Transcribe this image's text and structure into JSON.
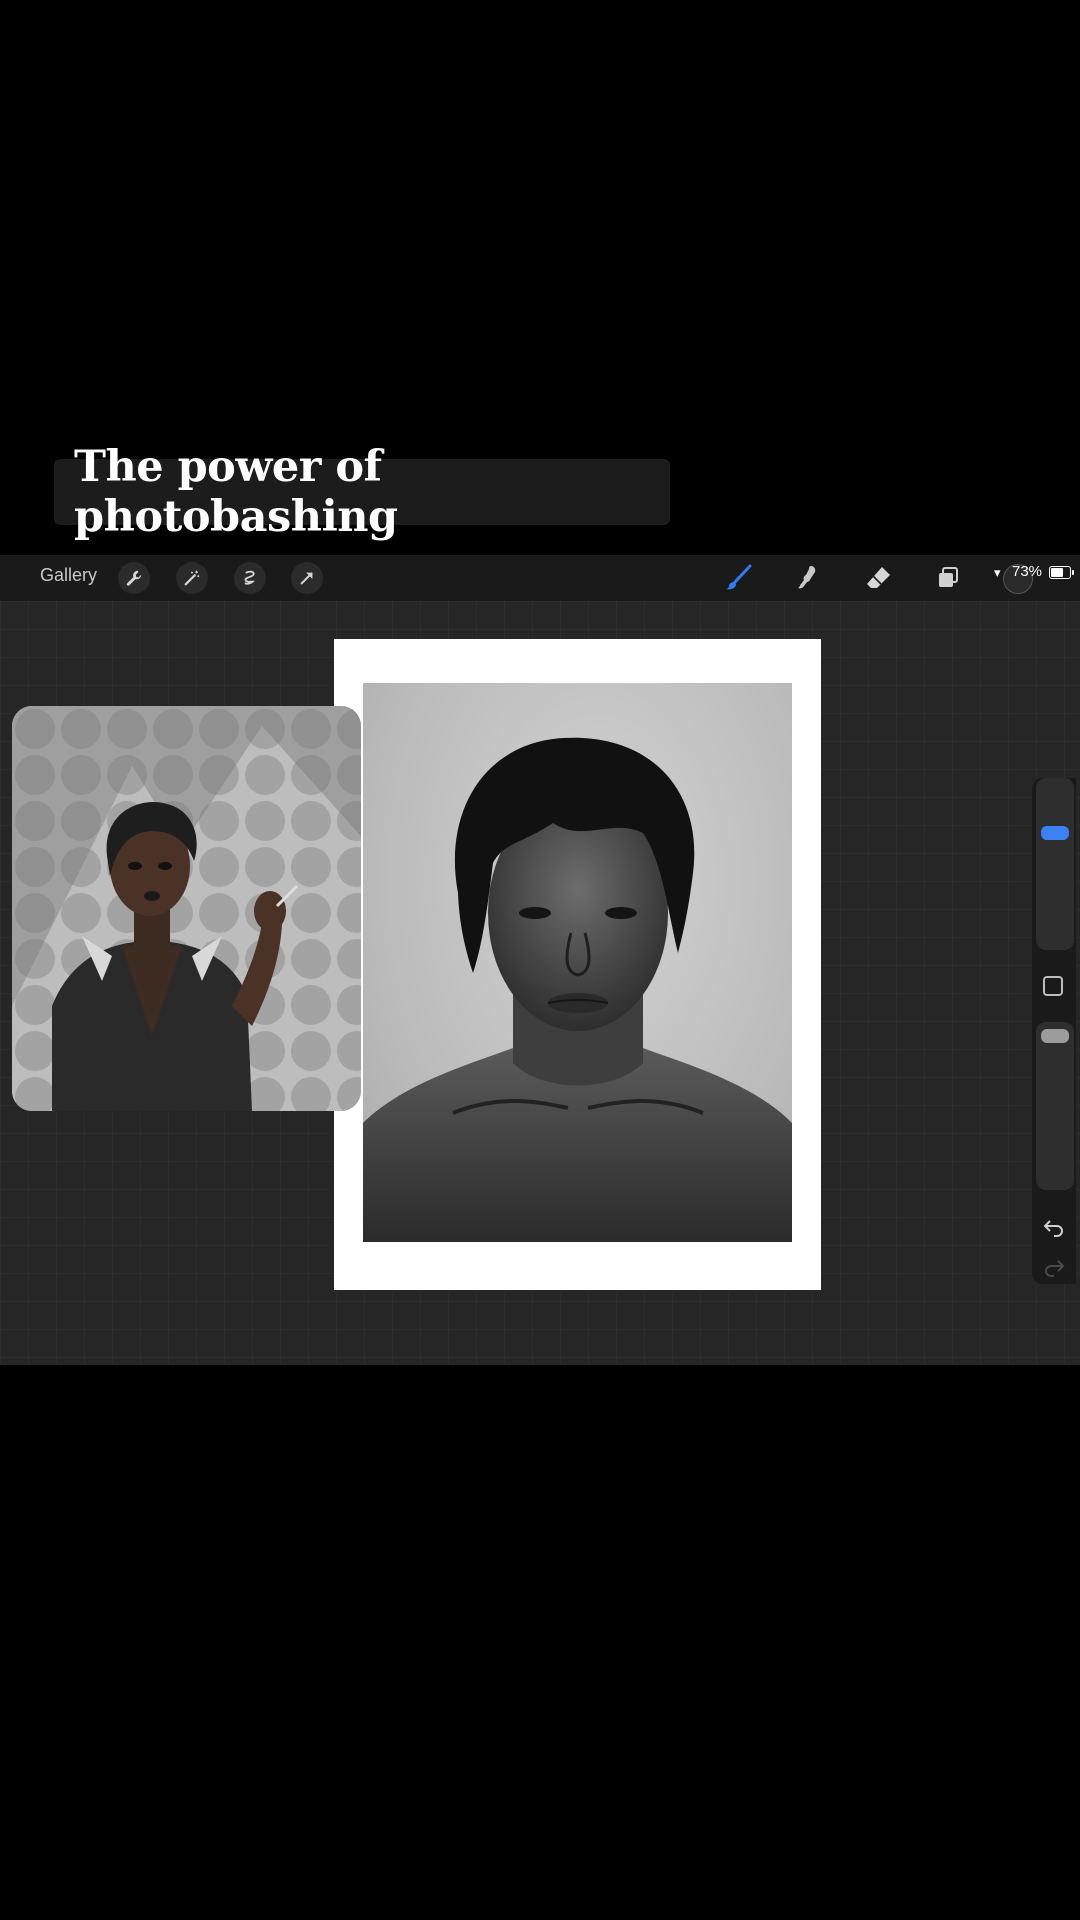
{
  "caption": {
    "text": "The power of photobashing"
  },
  "toolbar": {
    "gallery_label": "Gallery",
    "left_tools": [
      "wrench-icon",
      "magic-wand-icon",
      "selection-icon",
      "transform-arrow-icon"
    ],
    "right_tools": [
      "brush-icon",
      "smudge-icon",
      "eraser-icon",
      "layers-icon"
    ],
    "active_tool": "brush",
    "accent_color": "#2f7cf6"
  },
  "status": {
    "battery_text": "73%",
    "battery_level": 0.73
  },
  "sidebar": {
    "brush_size_level": 0.72,
    "opacity_level": 0.95
  }
}
